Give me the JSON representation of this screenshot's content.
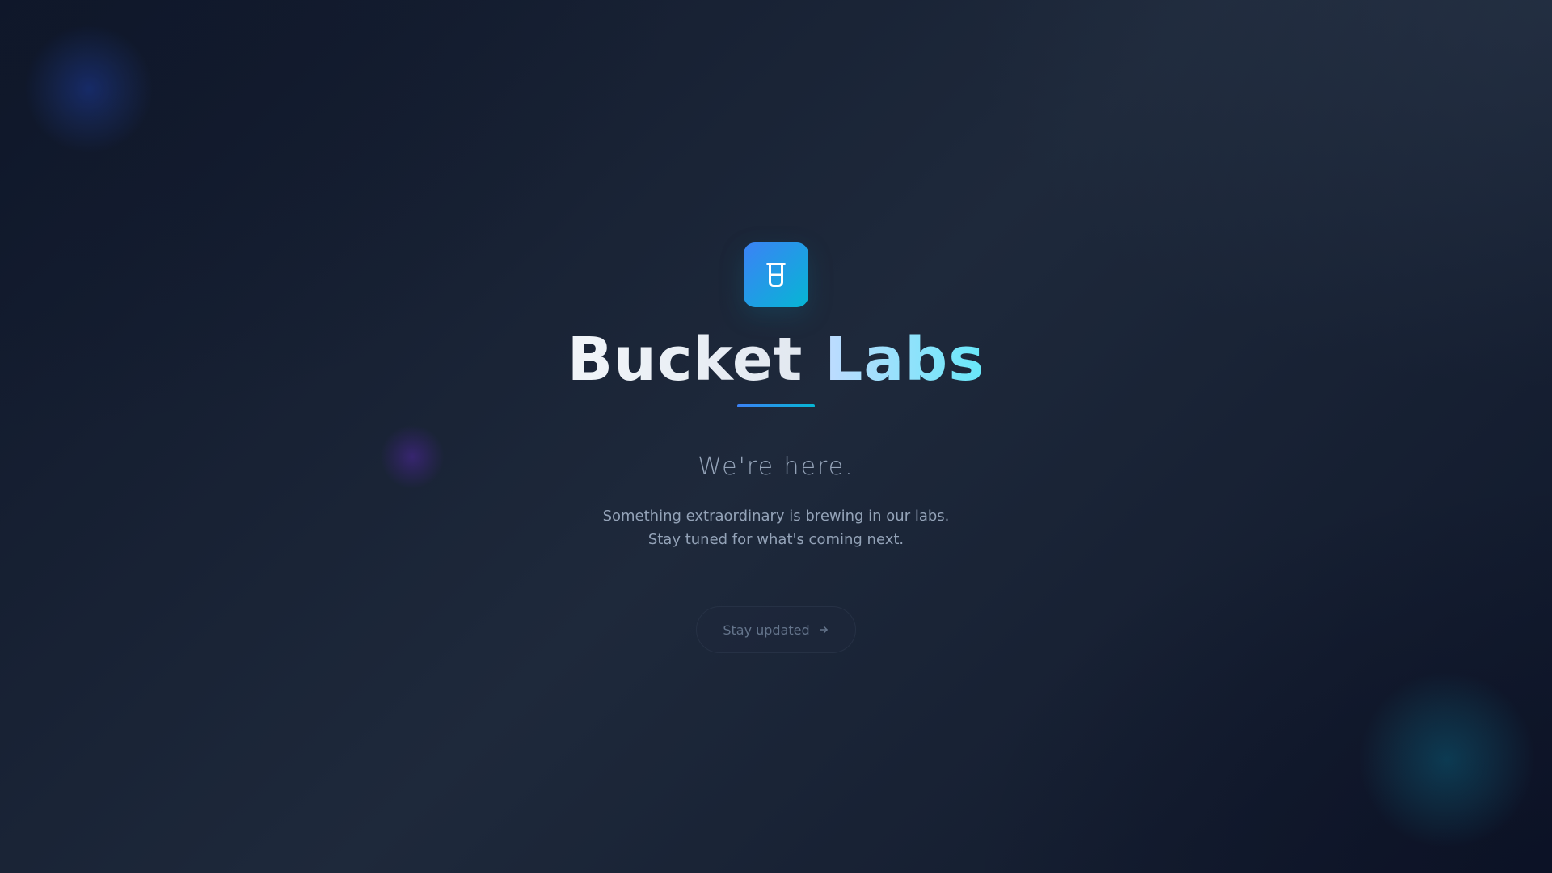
{
  "brand": {
    "title_part1": "Bucket",
    "title_part2": "Labs",
    "icon": "beaker-icon",
    "accent_start": "#3b82f6",
    "accent_end": "#06b6d4"
  },
  "hero": {
    "tagline": "We're here.",
    "description_line1": "Something extraordinary is brewing in our labs.",
    "description_line2": "Stay tuned for what's coming next."
  },
  "cta": {
    "label": "Stay updated",
    "icon": "arrow-right-icon"
  },
  "colors": {
    "background": "#1e293b",
    "muted_text": "#94a3b8",
    "button_text": "#64748b"
  }
}
